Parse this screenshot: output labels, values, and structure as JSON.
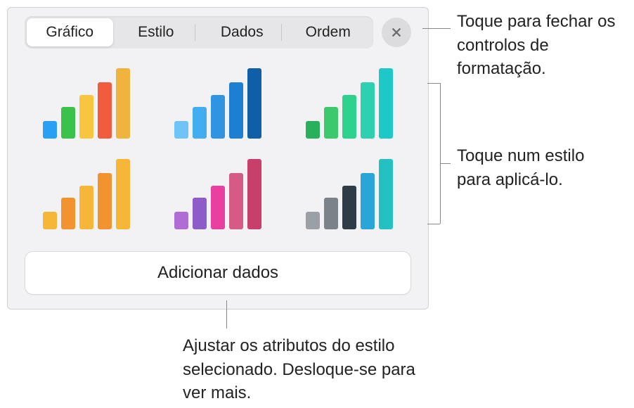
{
  "tabs": {
    "chart": "Gráfico",
    "style": "Estilo",
    "data": "Dados",
    "order": "Ordem"
  },
  "close_icon_name": "xmark",
  "add_data_label": "Adicionar dados",
  "callouts": {
    "close": "Toque para fechar os controlos de formatação.",
    "styles": "Toque num estilo para aplicá-lo.",
    "add": "Ajustar os atributos do estilo selecionado. Desloque-se para ver mais."
  }
}
